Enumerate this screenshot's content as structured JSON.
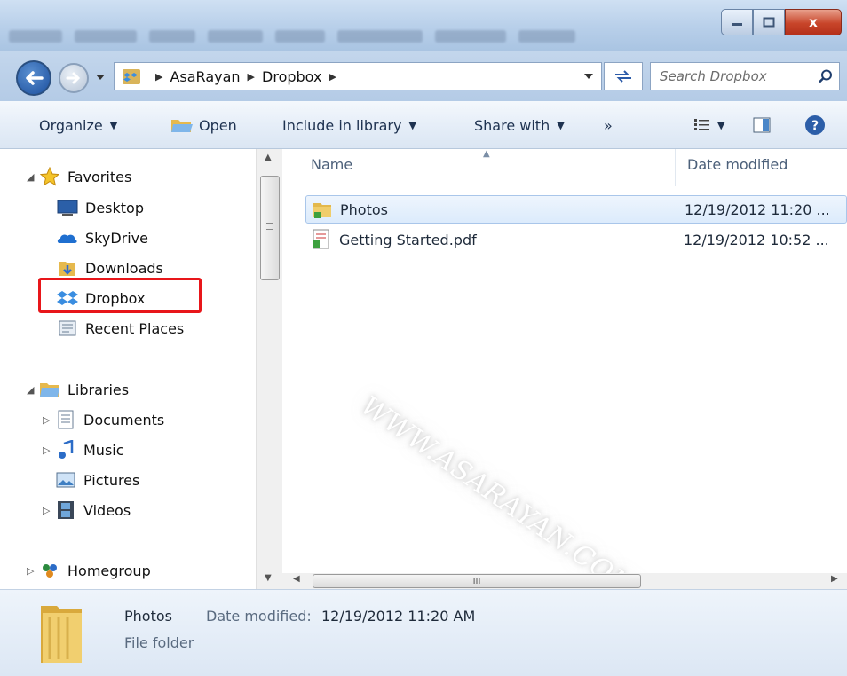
{
  "window": {
    "bookmarks_count_hint": "",
    "buttons": {
      "minimize": "minimize",
      "maximize": "maximize",
      "close": "x"
    }
  },
  "address": {
    "breadcrumbs": [
      "AsaRayan",
      "Dropbox"
    ],
    "search_placeholder": "Search Dropbox"
  },
  "toolbar": {
    "organize": "Organize",
    "open": "Open",
    "include_in_library": "Include in library",
    "share_with": "Share with",
    "more": "»"
  },
  "nav": {
    "favorites": {
      "label": "Favorites",
      "items": [
        "Desktop",
        "SkyDrive",
        "Downloads",
        "Dropbox",
        "Recent Places"
      ]
    },
    "libraries": {
      "label": "Libraries",
      "items": [
        "Documents",
        "Music",
        "Pictures",
        "Videos"
      ]
    },
    "homegroup": "Homegroup"
  },
  "columns": {
    "name": "Name",
    "date_modified": "Date modified"
  },
  "files": [
    {
      "name": "Photos",
      "date": "12/19/2012 11:20 ...",
      "type": "folder",
      "selected": true
    },
    {
      "name": "Getting Started.pdf",
      "date": "12/19/2012 10:52 ...",
      "type": "pdf",
      "selected": false
    }
  ],
  "watermark": "WWW.ASARAYAN.COM",
  "scroll": {
    "h_thumb_text": "III"
  },
  "details": {
    "name": "Photos",
    "date_label": "Date modified:",
    "date_value": "12/19/2012 11:20 AM",
    "type": "File folder"
  },
  "colors": {
    "highlight_box": "#e8161a",
    "selection": "#dcebfc"
  }
}
